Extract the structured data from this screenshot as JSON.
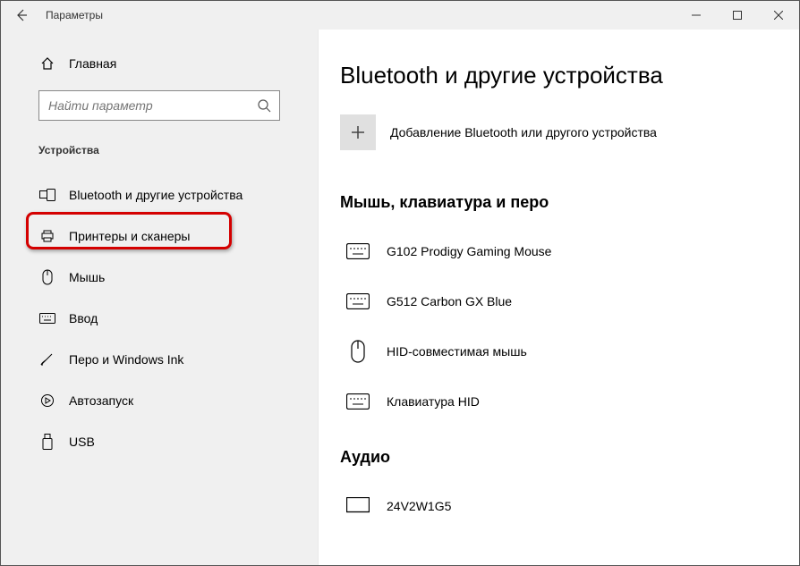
{
  "window": {
    "title": "Параметры"
  },
  "sidebar": {
    "home": "Главная",
    "search_placeholder": "Найти параметр",
    "section": "Устройства",
    "items": [
      {
        "label": "Bluetooth и другие устройства"
      },
      {
        "label": "Принтеры и сканеры"
      },
      {
        "label": "Мышь"
      },
      {
        "label": "Ввод"
      },
      {
        "label": "Перо и Windows Ink"
      },
      {
        "label": "Автозапуск"
      },
      {
        "label": "USB"
      }
    ]
  },
  "content": {
    "title": "Bluetooth и другие устройства",
    "add_label": "Добавление Bluetooth или другого устройства",
    "group1": "Мышь, клавиатура и перо",
    "devices": [
      {
        "label": "G102 Prodigy Gaming Mouse"
      },
      {
        "label": "G512 Carbon GX Blue"
      },
      {
        "label": "HID-совместимая мышь"
      },
      {
        "label": "Клавиатура HID"
      }
    ],
    "group2": "Аудио",
    "audio": [
      {
        "label": "24V2W1G5"
      }
    ]
  }
}
